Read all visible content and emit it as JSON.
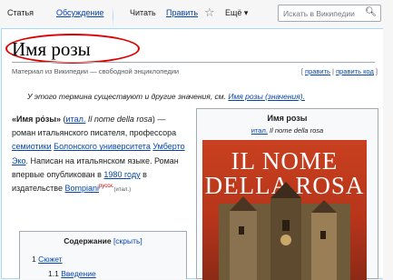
{
  "tabs": {
    "article": "Статья",
    "talk": "Обсуждение",
    "read": "Читать",
    "edit": "Править",
    "more": "Ещё ▾",
    "search_placeholder": "Искать в Википедии"
  },
  "page": {
    "title": "Имя розы",
    "tagline": "Материал из Википедии — свободной энциклопедии",
    "edit_link": "править",
    "edit_code_link": "править код",
    "hatnote": "У этого термина существуют и другие значения, см.",
    "hatnote_link": "Имя розы (значения)."
  },
  "lead": {
    "bold": "«Имя ро́зы»",
    "lang_link": "итал.",
    "orig": "Il nome della rosa",
    "t1": ") — роман итальянского писателя, профессора ",
    "semiotics": "семиотики",
    "university": "Болонского университета",
    "author": "Умберто Эко",
    "t2": ". Написан на итальянском языке. Роман впервые опубликован в ",
    "year": "1980 году",
    "t3": " в издательстве ",
    "publisher": "Bompiani",
    "rus_sup": "русск.",
    "ital_small": "(итал.)"
  },
  "infobox": {
    "title": "Имя розы",
    "lang": "итал.",
    "orig": "Il nome della rosa",
    "cover_line1": "IL NOME",
    "cover_line2": "DELLA ROSA"
  },
  "toc": {
    "title": "Содержание",
    "hide": "[скрыть]",
    "item1_num": "1",
    "item1": "Сюжет",
    "item2_num": "1.1",
    "item2": "Введение"
  },
  "colors": {
    "link": "#0645ad",
    "highlight": "#dd0000",
    "cover": "#b8351b"
  }
}
